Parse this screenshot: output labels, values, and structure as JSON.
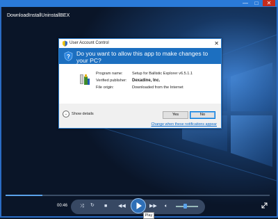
{
  "player": {
    "video_title": "DownloadInstallUninstallBEX",
    "elapsed_time": "00:46",
    "seek_progress": 0.14,
    "volume_level": 0.4,
    "play_tooltip": "Play"
  },
  "window_controls": {
    "minimize_icon": "—",
    "maximize_icon": "□",
    "close_icon": "✕"
  },
  "uac": {
    "title": "User Account Control",
    "question": "Do you want to allow this app to make changes to your PC?",
    "program_name_label": "Program name:",
    "program_name_value": "Setup for Ballistic Explorer v6.5.1.1",
    "publisher_label": "Verified publisher:",
    "publisher_value": "Dexadine, Inc.",
    "origin_label": "File origin:",
    "origin_value": "Downloaded from the Internet",
    "show_details": "Show details",
    "yes_label": "Yes",
    "no_label": "No",
    "notification_link": "Change when these notifications appear"
  },
  "colors": {
    "uac_banner": "#1c6fc0",
    "window_border": "#2a6cc4",
    "accent": "#5aa2ea"
  }
}
